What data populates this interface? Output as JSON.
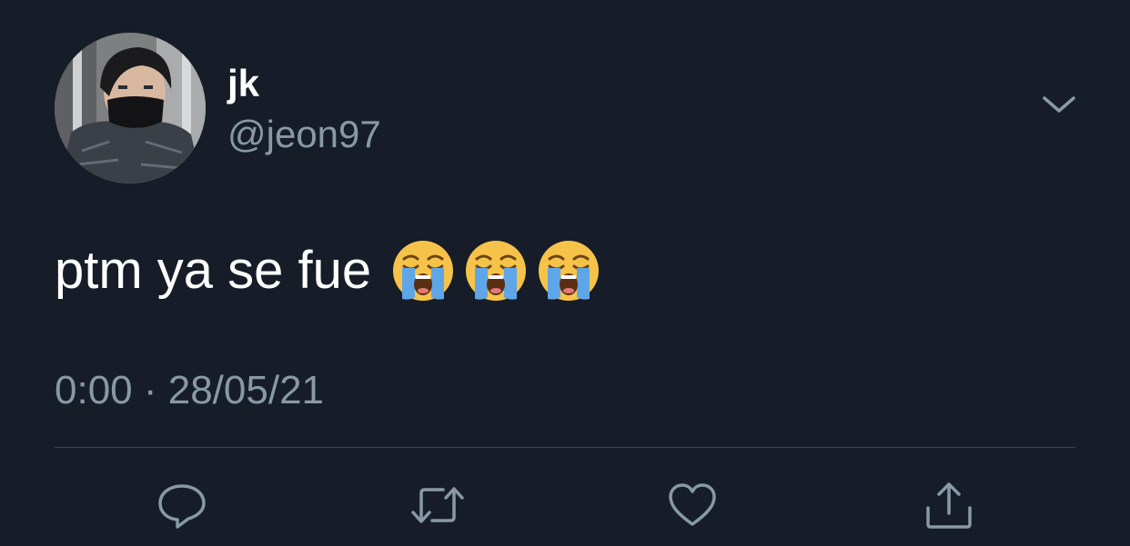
{
  "tweet": {
    "display_name": "jk",
    "handle": "@jeon97",
    "text": "ptm ya se fue",
    "emojis": [
      "loudly-crying-face",
      "loudly-crying-face",
      "loudly-crying-face"
    ],
    "timestamp": "0:00 · 28/05/21"
  },
  "icons": {
    "more": "chevron-down-icon",
    "reply": "reply-icon",
    "retweet": "retweet-icon",
    "like": "heart-icon",
    "share": "share-icon"
  },
  "colors": {
    "background": "#161d28",
    "primary_text": "#ffffff",
    "secondary_text": "#8899a6",
    "divider": "#38444d"
  }
}
